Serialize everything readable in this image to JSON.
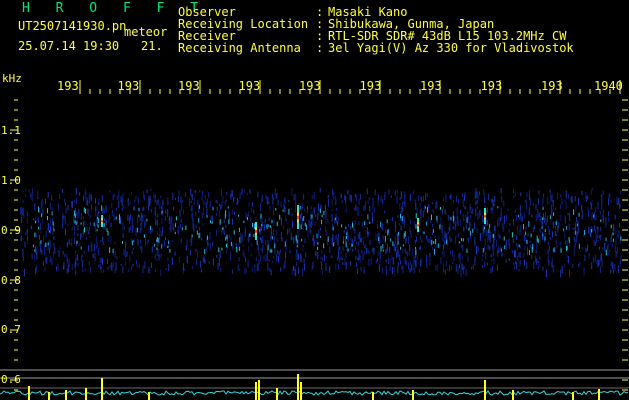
{
  "app": {
    "name": "H R O F F T",
    "filename": "UT2507141930.pn",
    "mode": "meteor",
    "timestamp": "25.07.14 19:30",
    "count": "21."
  },
  "station": [
    {
      "label": "Observer",
      "value": "Masaki Kano"
    },
    {
      "label": "Receiving Location",
      "value": "Shibukawa, Gunma, Japan"
    },
    {
      "label": "Receiver",
      "value": "RTL-SDR SDR# 43dB L15 103.2MHz CW"
    },
    {
      "label": "Receiving Antenna",
      "value": "3el Yagi(V) Az 330 for Vladivostok"
    }
  ],
  "axes": {
    "y_unit": "kHz",
    "x_ticks": [
      "193",
      "193",
      "193",
      "193",
      "193",
      "193",
      "193",
      "193",
      "193",
      "1940"
    ],
    "y_ticks": [
      "1.1",
      "1.0",
      "0.9",
      "0.8",
      "0.7",
      "0.6"
    ]
  },
  "colors": {
    "text": "#ffff3c",
    "title": "#00e676",
    "background": "#000000"
  }
}
